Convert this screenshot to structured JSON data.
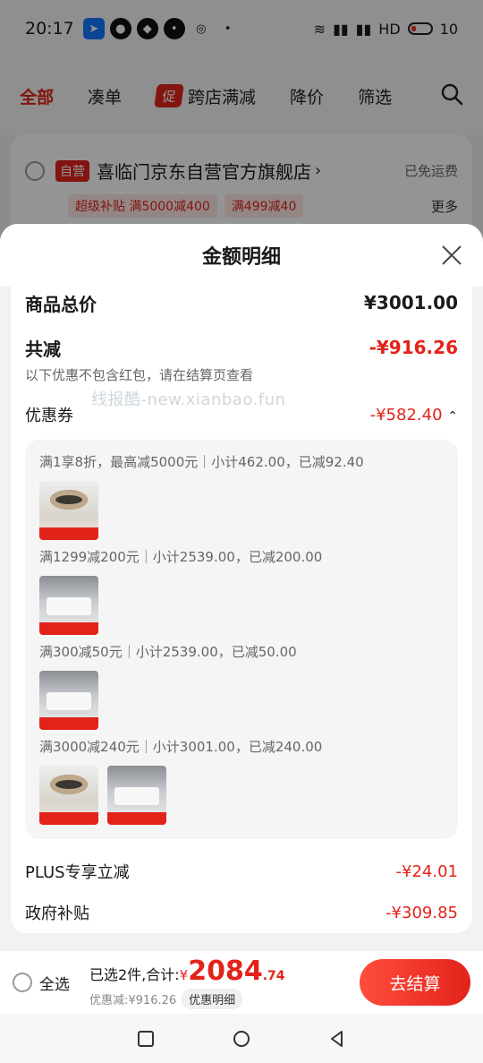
{
  "status_bar": {
    "time": "20:17",
    "right_text": "HD",
    "battery": "10",
    "icons": [
      "telegram-icon",
      "chat-icon",
      "qq-icon",
      "message-icon",
      "weibo-icon",
      "wifi-icon",
      "signal-5g-icon",
      "signal-5g-icon",
      "battery-icon"
    ]
  },
  "cart_tabs": [
    {
      "label": "全部",
      "active": true
    },
    {
      "label": "凑单",
      "active": false
    },
    {
      "label": "跨店满减",
      "active": false,
      "badge": "促"
    },
    {
      "label": "降价",
      "active": false
    },
    {
      "label": "筛选",
      "active": false
    }
  ],
  "store": {
    "tag": "自营",
    "name": "喜临门京东自营官方旗舰店",
    "free_shipping": "已免运费",
    "coupons": [
      "超级补贴 满5000减400",
      "满499减40"
    ],
    "more": "更多"
  },
  "sheet": {
    "title": "金额明细",
    "total_label": "商品总价",
    "total_value": "¥3001.00",
    "discount_label": "共减",
    "discount_value": "-¥916.26",
    "note": "以下优惠不包含红包，请在结算页查看",
    "watermark": "线报酷-new.xianbao.fun",
    "coupon_label": "优惠券",
    "coupon_value": "-¥582.40",
    "rules": [
      {
        "text": "满1享8折，最高减5000元｜小计462.00，已减92.40",
        "items": [
          "lamp"
        ]
      },
      {
        "text": "满1299减200元｜小计2539.00，已减200.00",
        "items": [
          "bed"
        ]
      },
      {
        "text": "满300减50元｜小计2539.00，已减50.00",
        "items": [
          "bed"
        ]
      },
      {
        "text": "满3000减240元｜小计3001.00，已减240.00",
        "items": [
          "lamp",
          "bed"
        ]
      }
    ],
    "plus_label": "PLUS专享立减",
    "plus_value": "-¥24.01",
    "gov_label": "政府补贴",
    "gov_value": "-¥309.85"
  },
  "bottom_bar": {
    "select_all": "全选",
    "selected_text": "已选2件,合计:",
    "currency": "¥",
    "price_int": "2084",
    "price_dec": ".74",
    "discount_text": "优惠减:¥916.26",
    "detail_chip": "优惠明细",
    "checkout": "去结算"
  },
  "colors": {
    "accent": "#e2231a"
  }
}
